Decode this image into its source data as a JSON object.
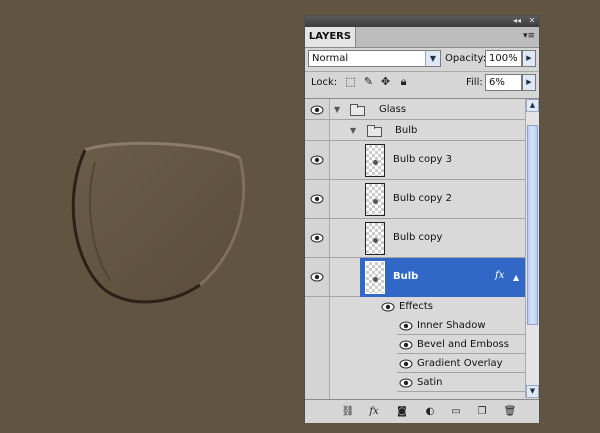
{
  "panel": {
    "tab_label": "LAYERS",
    "collapse_glyph": "◂◂",
    "close_glyph": "✕",
    "menu_glyph": "▾≡"
  },
  "blend": {
    "mode": "Normal",
    "opacity_label": "Opacity:",
    "opacity_value": "100%"
  },
  "lock": {
    "label": "Lock:",
    "fill_label": "Fill:",
    "fill_value": "6%"
  },
  "layers": [
    {
      "name": "Glass",
      "kind": "group",
      "visible": true
    },
    {
      "name": "Bulb",
      "kind": "group",
      "visible": false
    },
    {
      "name": "Bulb copy 3",
      "kind": "layer",
      "visible": true
    },
    {
      "name": "Bulb copy 2",
      "kind": "layer",
      "visible": true
    },
    {
      "name": "Bulb copy",
      "kind": "layer",
      "visible": true
    },
    {
      "name": "Bulb",
      "kind": "layer",
      "visible": true,
      "selected": true,
      "fx": "fx"
    }
  ],
  "effects": {
    "label": "Effects",
    "items": [
      "Inner Shadow",
      "Bevel and Emboss",
      "Gradient Overlay",
      "Satin"
    ]
  },
  "bottom": {
    "fx_label": "fx"
  },
  "colors": {
    "canvas": "#615440",
    "selection": "#3168c8",
    "panel": "#d6d6d6"
  }
}
